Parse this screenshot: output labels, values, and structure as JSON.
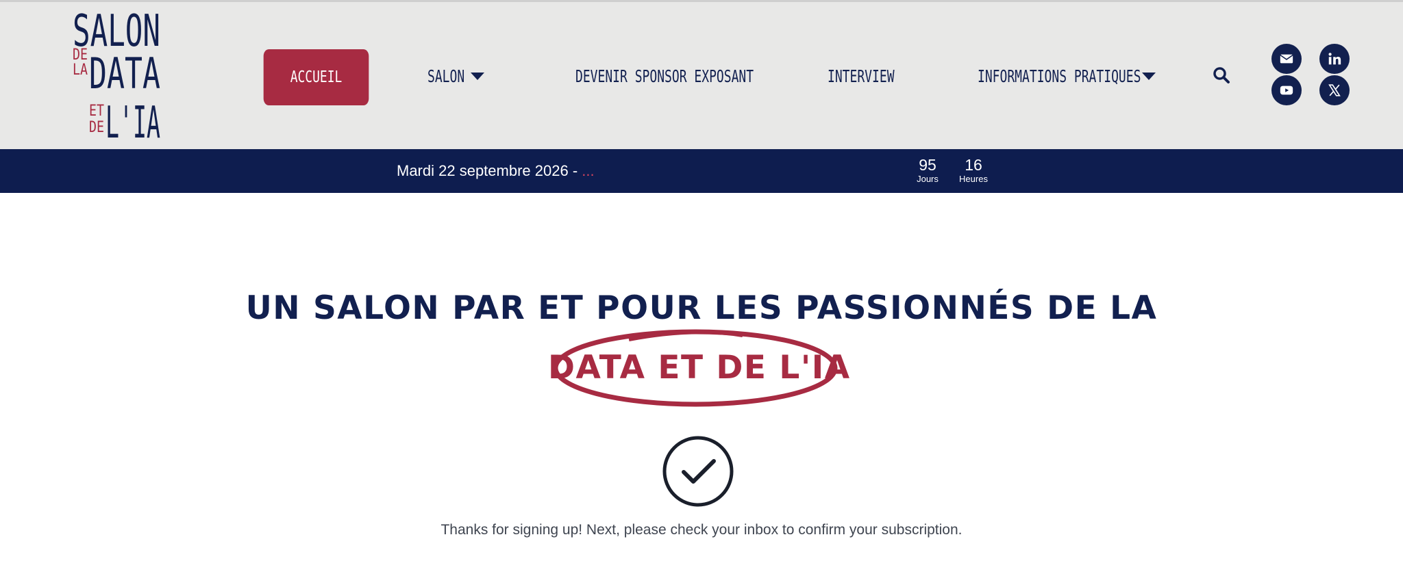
{
  "logo": {
    "line1": "SALON",
    "de_la": [
      "DE",
      "LA"
    ],
    "line2": "DATA",
    "et_de": [
      "ET",
      "DE"
    ],
    "line3": "L'IA"
  },
  "nav": {
    "items": [
      {
        "label": "ACCUEIL",
        "active": true
      },
      {
        "label": "SALON",
        "dropdown": true
      },
      {
        "label": "DEVENIR SPONSOR EXPOSANT"
      },
      {
        "label": "INTERVIEW"
      },
      {
        "label": "INFORMATIONS PRATIQUES",
        "dropdown": true
      }
    ],
    "search_icon": "search-icon"
  },
  "social": [
    "envelope-icon",
    "linkedin-icon",
    "youtube-icon",
    "x-icon"
  ],
  "infobar": {
    "date": "Mardi 22 septembre 2026 - ",
    "ellipsis": "...",
    "countdown": [
      {
        "value": "95",
        "label": "Jours"
      },
      {
        "value": "16",
        "label": "Heures"
      }
    ]
  },
  "main": {
    "headline": "UN SALON PAR ET POUR LES PASSIONNÉS DE LA",
    "highlight": "DATA ET DE L'IA",
    "thanks": "Thanks for signing up! Next, please check your inbox to confirm your subscription."
  },
  "colors": {
    "navy": "#12204f",
    "crimson": "#a72b42",
    "header_bg": "#e8e8e7",
    "bar_bg": "#0e1d4f"
  }
}
